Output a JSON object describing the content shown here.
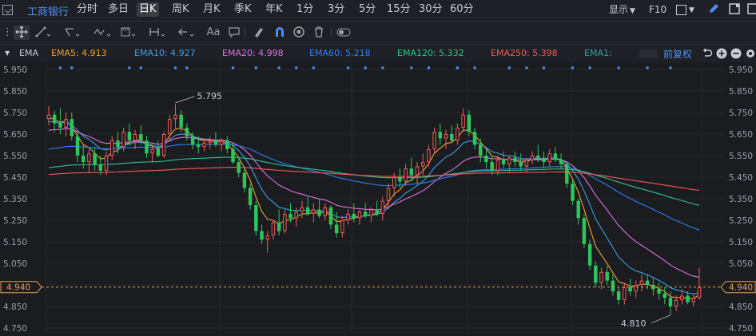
{
  "topbar": {
    "stock_name": "工商银行",
    "periods": [
      "分时",
      "多日",
      "日K",
      "周K",
      "月K",
      "季K",
      "年K",
      "1分",
      "3分",
      "5分",
      "15分",
      "30分",
      "60分"
    ],
    "active_period": "日K",
    "display_label": "显示",
    "f10_label": "F10"
  },
  "toolbar": {
    "text_tool": "Aa"
  },
  "ema_bar": {
    "title": "EMA",
    "items": [
      {
        "label": "EMA5: 4.913",
        "color": "#f0a030"
      },
      {
        "label": "EMA10: 4.927",
        "color": "#3aa0e8"
      },
      {
        "label": "EMA20: 4.998",
        "color": "#e070e0"
      },
      {
        "label": "EMA60: 5.218",
        "color": "#2f7ff0"
      },
      {
        "label": "EMA120: 5.332",
        "color": "#2ec58a"
      },
      {
        "label": "EMA250: 5.398",
        "color": "#f05a5a"
      },
      {
        "label": "EMA1:",
        "color": "#2aa7a0"
      }
    ],
    "adjust_label": "前复权"
  },
  "chart_data": {
    "type": "candlestick",
    "ylim": [
      4.75,
      5.95
    ],
    "ticks": [
      "5.950",
      "5.850",
      "5.750",
      "5.650",
      "5.550",
      "5.450",
      "5.350",
      "5.250",
      "5.150",
      "5.050",
      "4.950",
      "4.850",
      "4.750"
    ],
    "current_price": "4.940",
    "max_annotation": "5.795",
    "min_annotation": "4.810",
    "colors": {
      "up": "#f05a5a",
      "down": "#2ec55a",
      "ema5": "#f0a030",
      "ema10": "#3aa0e8",
      "ema20": "#e070e0",
      "ema60": "#2f7ff0",
      "ema120": "#2ec58a",
      "ema250": "#f05a5a",
      "price_line": "#e0a050",
      "dots": "#4f8df5"
    },
    "candles": [
      [
        5.72,
        5.78,
        5.69,
        5.74
      ],
      [
        5.74,
        5.76,
        5.66,
        5.7
      ],
      [
        5.7,
        5.77,
        5.65,
        5.68
      ],
      [
        5.68,
        5.75,
        5.64,
        5.72
      ],
      [
        5.72,
        5.75,
        5.62,
        5.64
      ],
      [
        5.64,
        5.66,
        5.52,
        5.55
      ],
      [
        5.55,
        5.6,
        5.49,
        5.52
      ],
      [
        5.52,
        5.58,
        5.47,
        5.56
      ],
      [
        5.56,
        5.59,
        5.48,
        5.51
      ],
      [
        5.51,
        5.55,
        5.46,
        5.48
      ],
      [
        5.48,
        5.57,
        5.46,
        5.55
      ],
      [
        5.55,
        5.64,
        5.53,
        5.62
      ],
      [
        5.62,
        5.66,
        5.56,
        5.59
      ],
      [
        5.59,
        5.68,
        5.57,
        5.66
      ],
      [
        5.66,
        5.7,
        5.6,
        5.62
      ],
      [
        5.62,
        5.67,
        5.58,
        5.65
      ],
      [
        5.65,
        5.69,
        5.6,
        5.62
      ],
      [
        5.62,
        5.64,
        5.54,
        5.56
      ],
      [
        5.56,
        5.6,
        5.52,
        5.58
      ],
      [
        5.58,
        5.62,
        5.54,
        5.55
      ],
      [
        5.55,
        5.66,
        5.54,
        5.65
      ],
      [
        5.65,
        5.74,
        5.62,
        5.72
      ],
      [
        5.72,
        5.79,
        5.68,
        5.74
      ],
      [
        5.74,
        5.76,
        5.66,
        5.68
      ],
      [
        5.68,
        5.7,
        5.62,
        5.64
      ],
      [
        5.64,
        5.66,
        5.58,
        5.6
      ],
      [
        5.6,
        5.64,
        5.56,
        5.59
      ],
      [
        5.59,
        5.63,
        5.57,
        5.61
      ],
      [
        5.61,
        5.64,
        5.58,
        5.62
      ],
      [
        5.62,
        5.66,
        5.59,
        5.6
      ],
      [
        5.6,
        5.63,
        5.57,
        5.62
      ],
      [
        5.62,
        5.64,
        5.56,
        5.58
      ],
      [
        5.58,
        5.61,
        5.51,
        5.52
      ],
      [
        5.52,
        5.54,
        5.45,
        5.47
      ],
      [
        5.47,
        5.49,
        5.38,
        5.4
      ],
      [
        5.4,
        5.42,
        5.3,
        5.32
      ],
      [
        5.32,
        5.34,
        5.18,
        5.2
      ],
      [
        5.2,
        5.23,
        5.14,
        5.16
      ],
      [
        5.16,
        5.2,
        5.1,
        5.18
      ],
      [
        5.18,
        5.25,
        5.16,
        5.24
      ],
      [
        5.24,
        5.3,
        5.18,
        5.2
      ],
      [
        5.2,
        5.3,
        5.19,
        5.28
      ],
      [
        5.28,
        5.33,
        5.24,
        5.26
      ],
      [
        5.26,
        5.31,
        5.22,
        5.29
      ],
      [
        5.29,
        5.34,
        5.26,
        5.31
      ],
      [
        5.31,
        5.36,
        5.27,
        5.28
      ],
      [
        5.28,
        5.33,
        5.24,
        5.3
      ],
      [
        5.3,
        5.35,
        5.26,
        5.27
      ],
      [
        5.27,
        5.33,
        5.25,
        5.31
      ],
      [
        5.31,
        5.32,
        5.21,
        5.23
      ],
      [
        5.23,
        5.29,
        5.17,
        5.19
      ],
      [
        5.19,
        5.27,
        5.17,
        5.25
      ],
      [
        5.25,
        5.3,
        5.23,
        5.28
      ],
      [
        5.28,
        5.33,
        5.24,
        5.26
      ],
      [
        5.26,
        5.3,
        5.23,
        5.29
      ],
      [
        5.29,
        5.33,
        5.26,
        5.27
      ],
      [
        5.27,
        5.31,
        5.24,
        5.3
      ],
      [
        5.3,
        5.34,
        5.27,
        5.28
      ],
      [
        5.28,
        5.36,
        5.25,
        5.34
      ],
      [
        5.34,
        5.42,
        5.3,
        5.4
      ],
      [
        5.4,
        5.47,
        5.36,
        5.45
      ],
      [
        5.45,
        5.49,
        5.4,
        5.43
      ],
      [
        5.43,
        5.51,
        5.41,
        5.49
      ],
      [
        5.49,
        5.54,
        5.43,
        5.46
      ],
      [
        5.46,
        5.52,
        5.42,
        5.5
      ],
      [
        5.5,
        5.56,
        5.46,
        5.52
      ],
      [
        5.52,
        5.6,
        5.5,
        5.58
      ],
      [
        5.58,
        5.68,
        5.56,
        5.66
      ],
      [
        5.66,
        5.7,
        5.6,
        5.63
      ],
      [
        5.63,
        5.67,
        5.58,
        5.65
      ],
      [
        5.65,
        5.69,
        5.61,
        5.62
      ],
      [
        5.62,
        5.7,
        5.6,
        5.68
      ],
      [
        5.68,
        5.77,
        5.66,
        5.74
      ],
      [
        5.74,
        5.76,
        5.64,
        5.66
      ],
      [
        5.66,
        5.68,
        5.58,
        5.6
      ],
      [
        5.6,
        5.63,
        5.52,
        5.55
      ],
      [
        5.55,
        5.58,
        5.49,
        5.52
      ],
      [
        5.52,
        5.55,
        5.46,
        5.48
      ],
      [
        5.48,
        5.55,
        5.46,
        5.53
      ],
      [
        5.53,
        5.57,
        5.49,
        5.51
      ],
      [
        5.51,
        5.55,
        5.47,
        5.54
      ],
      [
        5.54,
        5.57,
        5.5,
        5.52
      ],
      [
        5.52,
        5.56,
        5.48,
        5.5
      ],
      [
        5.5,
        5.54,
        5.47,
        5.53
      ],
      [
        5.53,
        5.57,
        5.51,
        5.55
      ],
      [
        5.55,
        5.6,
        5.52,
        5.54
      ],
      [
        5.54,
        5.57,
        5.49,
        5.52
      ],
      [
        5.52,
        5.58,
        5.5,
        5.56
      ],
      [
        5.56,
        5.59,
        5.52,
        5.53
      ],
      [
        5.53,
        5.56,
        5.49,
        5.51
      ],
      [
        5.51,
        5.52,
        5.4,
        5.42
      ],
      [
        5.42,
        5.44,
        5.32,
        5.34
      ],
      [
        5.34,
        5.35,
        5.23,
        5.26
      ],
      [
        5.26,
        5.28,
        5.12,
        5.14
      ],
      [
        5.14,
        5.16,
        5.02,
        5.04
      ],
      [
        5.04,
        5.06,
        4.94,
        4.96
      ],
      [
        4.96,
        5.03,
        4.93,
        5.01
      ],
      [
        5.01,
        5.04,
        4.95,
        4.97
      ],
      [
        4.97,
        5.0,
        4.9,
        4.92
      ],
      [
        4.92,
        4.94,
        4.86,
        4.88
      ],
      [
        4.88,
        4.96,
        4.86,
        4.94
      ],
      [
        4.94,
        4.98,
        4.9,
        4.92
      ],
      [
        4.92,
        4.97,
        4.89,
        4.95
      ],
      [
        4.95,
        5.0,
        4.92,
        4.97
      ],
      [
        4.97,
        5.0,
        4.93,
        4.95
      ],
      [
        4.95,
        4.98,
        4.9,
        4.93
      ],
      [
        4.93,
        4.96,
        4.88,
        4.91
      ],
      [
        4.91,
        4.94,
        4.86,
        4.89
      ],
      [
        4.89,
        4.92,
        4.81,
        4.85
      ],
      [
        4.85,
        4.9,
        4.83,
        4.88
      ],
      [
        4.88,
        4.93,
        4.86,
        4.9
      ],
      [
        4.9,
        4.92,
        4.86,
        4.87
      ],
      [
        4.87,
        4.91,
        4.85,
        4.89
      ],
      [
        4.89,
        5.03,
        4.88,
        4.94
      ]
    ]
  }
}
